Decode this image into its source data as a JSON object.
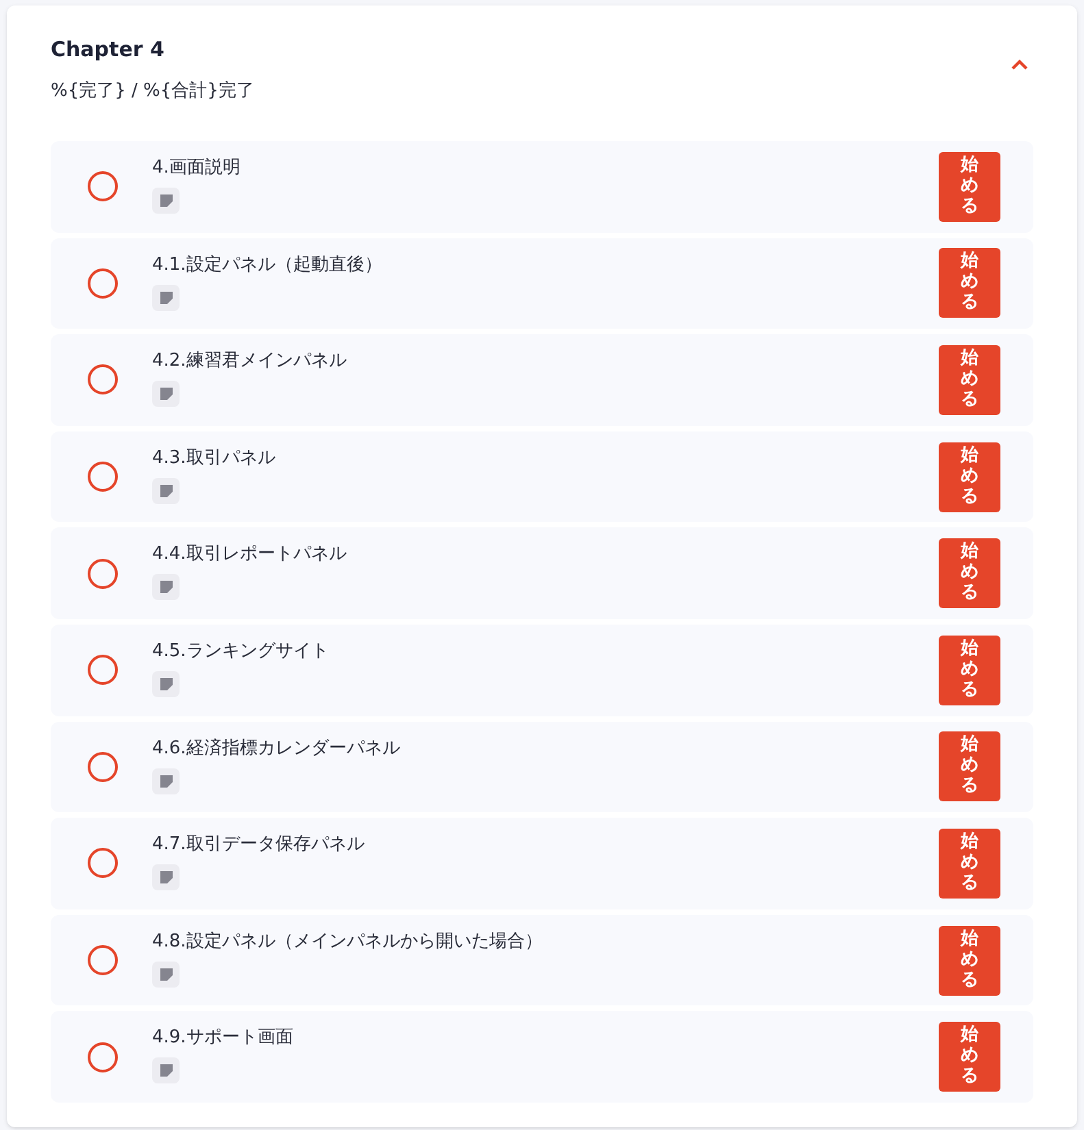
{
  "chapter": {
    "title": "Chapter 4",
    "progress": "%{完了} / %{合計}完了",
    "expanded": true
  },
  "lessons": [
    {
      "title": "4.画面説明",
      "completed": false,
      "button": "始める"
    },
    {
      "title": "4.1.設定パネル（起動直後）",
      "completed": false,
      "button": "始める"
    },
    {
      "title": "4.2.練習君メインパネル",
      "completed": false,
      "button": "始める"
    },
    {
      "title": "4.3.取引パネル",
      "completed": false,
      "button": "始める"
    },
    {
      "title": "4.4.取引レポートパネル",
      "completed": false,
      "button": "始める"
    },
    {
      "title": "4.5.ランキングサイト",
      "completed": false,
      "button": "始める"
    },
    {
      "title": "4.6.経済指標カレンダーパネル",
      "completed": false,
      "button": "始める"
    },
    {
      "title": "4.7.取引データ保存パネル",
      "completed": false,
      "button": "始める"
    },
    {
      "title": "4.8.設定パネル（メインパネルから開いた場合）",
      "completed": false,
      "button": "始める"
    },
    {
      "title": "4.9.サポート画面",
      "completed": false,
      "button": "始める"
    }
  ]
}
